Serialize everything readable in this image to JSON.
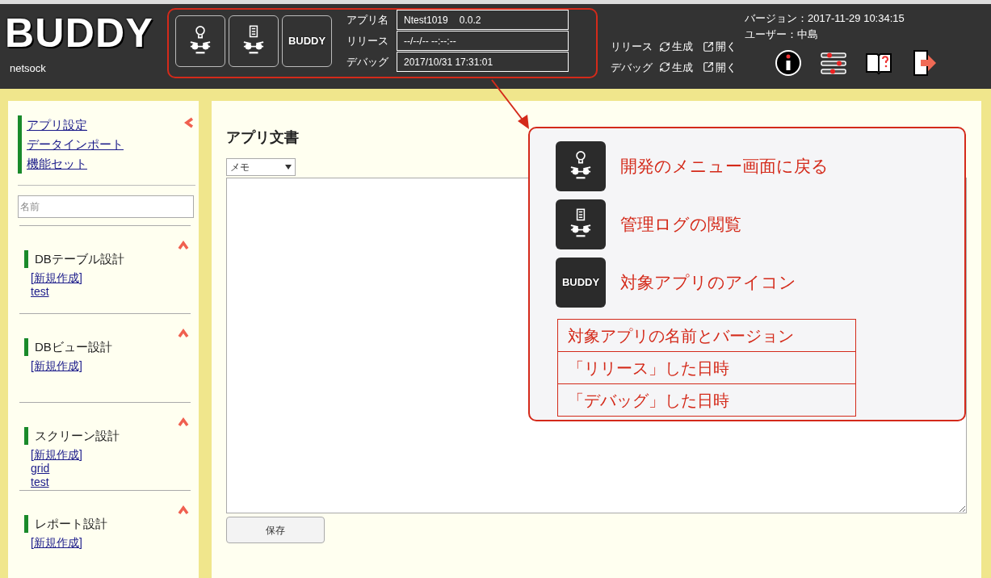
{
  "header": {
    "logo": "BUDDY",
    "company": "netsock",
    "tool_buttons": [
      {
        "kind": "bulb"
      },
      {
        "kind": "log"
      },
      {
        "kind": "app_icon",
        "text": "BUDDY"
      }
    ],
    "app_info": [
      {
        "label": "アプリ名",
        "value": "Ntest1019",
        "version": "0.0.2"
      },
      {
        "label": "リリース",
        "value": "--/--/-- --:--:--"
      },
      {
        "label": "デバッグ",
        "value": "2017/10/31 17:31:01"
      }
    ],
    "builds": [
      {
        "label": "リリース",
        "generate": "生成",
        "open": "開く"
      },
      {
        "label": "デバッグ",
        "generate": "生成",
        "open": "開く"
      }
    ],
    "version": "バージョン：2017-11-29 10:34:15",
    "user": "ユーザー：中島",
    "icons": [
      {
        "kind": "info"
      },
      {
        "kind": "settings"
      },
      {
        "kind": "manual"
      },
      {
        "kind": "logout"
      }
    ]
  },
  "sidebar": {
    "links": [
      "アプリ設定",
      "データインポート",
      "機能セット"
    ],
    "search": {
      "placeholder": "名前"
    },
    "sections": [
      {
        "title": "DBテーブル設計",
        "expanded": true,
        "items": [
          "[新規作成]",
          "test"
        ]
      },
      {
        "title": "DBビュー設計",
        "expanded": true,
        "items": [
          "[新規作成]"
        ]
      },
      {
        "title": "スクリーン設計",
        "expanded": true,
        "items": [
          "[新規作成]",
          "grid",
          "test"
        ]
      },
      {
        "title": "レポート設計",
        "expanded": true,
        "items": [
          "[新規作成]"
        ]
      }
    ]
  },
  "main": {
    "title": "アプリ文書",
    "doc_type": "メモ",
    "save": "保存"
  },
  "annotation": {
    "items": [
      {
        "kind": "bulb",
        "text": "開発のメニュー画面に戻る"
      },
      {
        "kind": "log",
        "text": "管理ログの閲覧"
      },
      {
        "kind": "app_icon",
        "icon_text": "BUDDY",
        "text": "対象アプリのアイコン"
      }
    ],
    "rows": [
      "対象アプリの名前とバージョン",
      "「リリース」した日時",
      "「デバッグ」した日時"
    ]
  }
}
